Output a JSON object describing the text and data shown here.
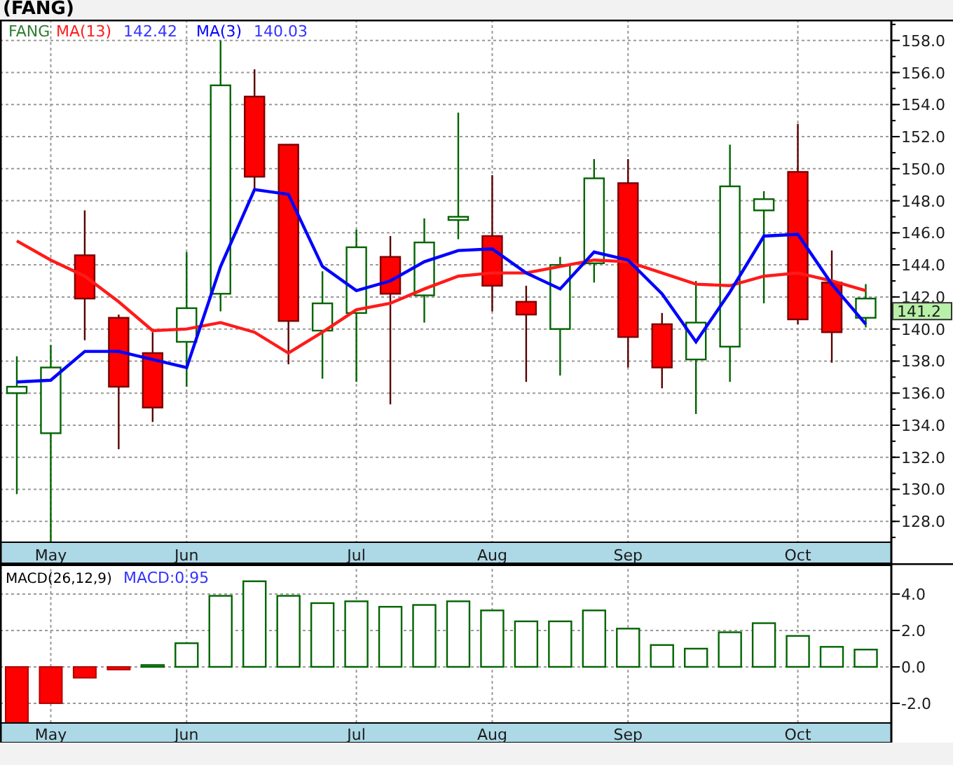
{
  "title": "(FANG)",
  "price_chart": {
    "legend": {
      "symbol": "FANG",
      "values": [
        "142.42",
        "140.03"
      ]
    },
    "last_price": "141.2",
    "chart_data": {
      "type": "candlestick",
      "categories": [
        null,
        "May",
        null,
        null,
        null,
        "Jun",
        null,
        null,
        null,
        null,
        "Jul",
        null,
        null,
        null,
        "Aug",
        null,
        null,
        null,
        "Sep",
        null,
        null,
        null,
        null,
        "Oct",
        null,
        null
      ],
      "ylim": [
        126.7,
        159.3
      ],
      "grid": true,
      "yticks": [
        {
          "value": 128,
          "label": "128.0"
        },
        {
          "value": 130,
          "label": "130.0"
        },
        {
          "value": 132,
          "label": "132.0"
        },
        {
          "value": 134,
          "label": "134.0"
        },
        {
          "value": 136,
          "label": "136.0"
        },
        {
          "value": 138,
          "label": "138.0"
        },
        {
          "value": 140,
          "label": "140.0"
        },
        {
          "value": 142,
          "label": "142.0"
        },
        {
          "value": 144,
          "label": "144.0"
        },
        {
          "value": 146,
          "label": "146.0"
        },
        {
          "value": 148,
          "label": "148.0"
        },
        {
          "value": 150,
          "label": "150.0"
        },
        {
          "value": 152,
          "label": "152.0"
        },
        {
          "value": 154,
          "label": "154.0"
        },
        {
          "value": 156,
          "label": "156.0"
        },
        {
          "value": 158,
          "label": "158.0"
        }
      ],
      "ohlc": [
        [
          136.0,
          138.3,
          129.7,
          136.4
        ],
        [
          133.5,
          139.0,
          126.6,
          137.6
        ],
        [
          144.6,
          147.4,
          139.3,
          141.9
        ],
        [
          140.7,
          140.9,
          132.5,
          136.4
        ],
        [
          138.5,
          139.8,
          134.2,
          135.1
        ],
        [
          139.2,
          144.8,
          136.4,
          141.3
        ],
        [
          142.2,
          158.0,
          141.1,
          155.2
        ],
        [
          154.5,
          156.2,
          148.6,
          149.5
        ],
        [
          151.5,
          151.5,
          137.8,
          140.5
        ],
        [
          139.9,
          143.6,
          136.9,
          141.6
        ],
        [
          141.0,
          146.2,
          136.7,
          145.1
        ],
        [
          144.5,
          145.8,
          135.3,
          142.2
        ],
        [
          142.1,
          146.9,
          140.4,
          145.4
        ],
        [
          146.8,
          153.5,
          145.6,
          147.0
        ],
        [
          145.8,
          149.6,
          141.1,
          142.7
        ],
        [
          141.7,
          142.7,
          136.7,
          140.9
        ],
        [
          140.0,
          144.5,
          137.1,
          144.0
        ],
        [
          144.1,
          150.6,
          142.9,
          149.4
        ],
        [
          149.1,
          150.6,
          137.6,
          139.5
        ],
        [
          140.3,
          141.0,
          136.3,
          137.6
        ],
        [
          138.1,
          143.0,
          134.7,
          140.4
        ],
        [
          138.9,
          151.5,
          136.7,
          148.9
        ],
        [
          147.4,
          148.6,
          141.6,
          148.1
        ],
        [
          149.8,
          152.8,
          140.3,
          140.6
        ],
        [
          142.9,
          144.9,
          137.9,
          139.8
        ],
        [
          140.7,
          142.8,
          140.1,
          141.9
        ]
      ],
      "series": [
        {
          "name": "MA(13)",
          "type": "line",
          "color": "#ff1a1a",
          "values": [
            145.5,
            144.3,
            143.3,
            141.7,
            139.9,
            140.0,
            140.4,
            139.8,
            138.5,
            139.8,
            141.2,
            141.6,
            142.5,
            143.3,
            143.5,
            143.5,
            143.9,
            144.3,
            144.2,
            143.5,
            142.8,
            142.7,
            143.3,
            143.5,
            143.0,
            142.4
          ]
        },
        {
          "name": "MA(3)",
          "type": "line",
          "color": "#0000ff",
          "values": [
            136.7,
            136.8,
            138.6,
            138.6,
            138.1,
            137.6,
            143.9,
            148.7,
            148.4,
            143.9,
            142.4,
            143.0,
            144.2,
            144.9,
            145.0,
            143.5,
            142.5,
            144.8,
            144.3,
            142.2,
            139.2,
            142.3,
            145.8,
            145.9,
            142.8,
            140.3
          ]
        }
      ]
    }
  },
  "macd_chart": {
    "legend": {
      "value": "MACD:0.95"
    },
    "chart_data": {
      "type": "bar",
      "title": "MACD(26,12,9)",
      "categories": [
        null,
        "May",
        null,
        null,
        null,
        "Jun",
        null,
        null,
        null,
        null,
        "Jul",
        null,
        null,
        null,
        "Aug",
        null,
        null,
        null,
        "Sep",
        null,
        null,
        null,
        null,
        "Oct",
        null,
        null
      ],
      "ylim": [
        -3.08,
        5.69
      ],
      "grid": true,
      "yticks": [
        {
          "value": -2,
          "label": "-2.0"
        },
        {
          "value": 0,
          "label": "0.0"
        },
        {
          "value": 2,
          "label": "2.0"
        },
        {
          "value": 4,
          "label": "4.0"
        }
      ],
      "values": [
        -3.08,
        -2.0,
        -0.6,
        -0.15,
        0.1,
        1.3,
        3.9,
        4.7,
        3.9,
        3.5,
        3.6,
        3.3,
        3.4,
        3.6,
        3.1,
        2.5,
        2.5,
        3.1,
        2.1,
        1.2,
        1.0,
        1.9,
        2.4,
        1.7,
        1.1,
        0.95
      ]
    }
  }
}
